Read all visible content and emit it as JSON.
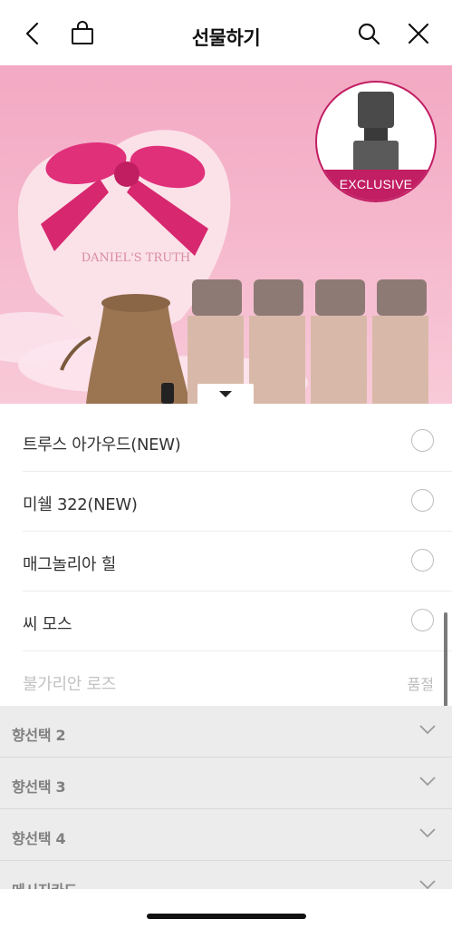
{
  "header": {
    "title": "선물하기",
    "icons": [
      "back-icon",
      "bag-icon",
      "search-icon",
      "close-icon"
    ]
  },
  "hero": {
    "badge_text": "EXCLUSIVE",
    "brand_text": "DANIEL'S TRUTH"
  },
  "options": [
    {
      "label": "트루스 아가우드(NEW)",
      "status": ""
    },
    {
      "label": "미쉘 322(NEW)",
      "status": ""
    },
    {
      "label": "매그놀리아 힐",
      "status": ""
    },
    {
      "label": "씨 모스",
      "status": ""
    },
    {
      "label": "불가리안 로즈",
      "status": "품절"
    }
  ],
  "sections": [
    {
      "label": "향선택 2"
    },
    {
      "label": "향선택 3"
    },
    {
      "label": "향선택 4"
    },
    {
      "label": "메시지카드"
    }
  ],
  "colors": {
    "accent": "#c21e63",
    "hero_pink": "#f5b6cc",
    "section_bg": "#ececec"
  }
}
